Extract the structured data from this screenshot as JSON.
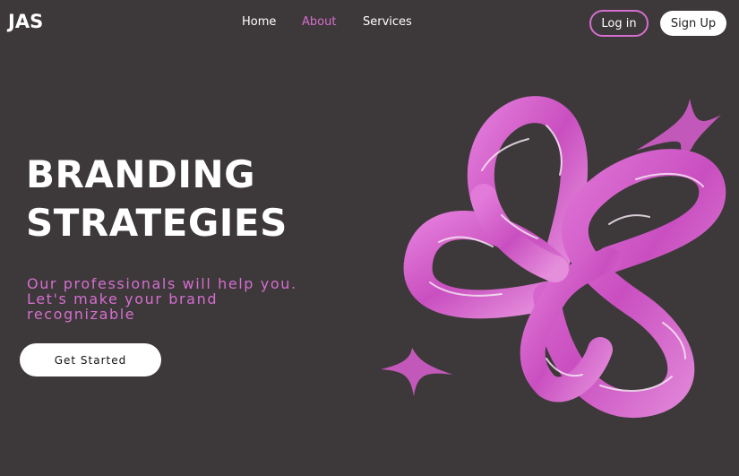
{
  "brand": {
    "logo": "JAS"
  },
  "nav": {
    "items": [
      {
        "label": "Home",
        "active": false
      },
      {
        "label": "About",
        "active": true
      },
      {
        "label": "Services",
        "active": false
      }
    ]
  },
  "auth": {
    "login_label": "Log in",
    "signup_label": "Sign Up"
  },
  "hero": {
    "title_line1": "BRANDING",
    "title_line2": "STRATEGIES",
    "subtitle": "Our professionals will help you. Let's make your brand recognizable",
    "cta_label": "Get Started"
  },
  "colors": {
    "background": "#3d3839",
    "accent": "#d46fcf",
    "text": "#ffffff"
  },
  "art": {
    "name": "pink-3d-knot-with-sparkles"
  }
}
